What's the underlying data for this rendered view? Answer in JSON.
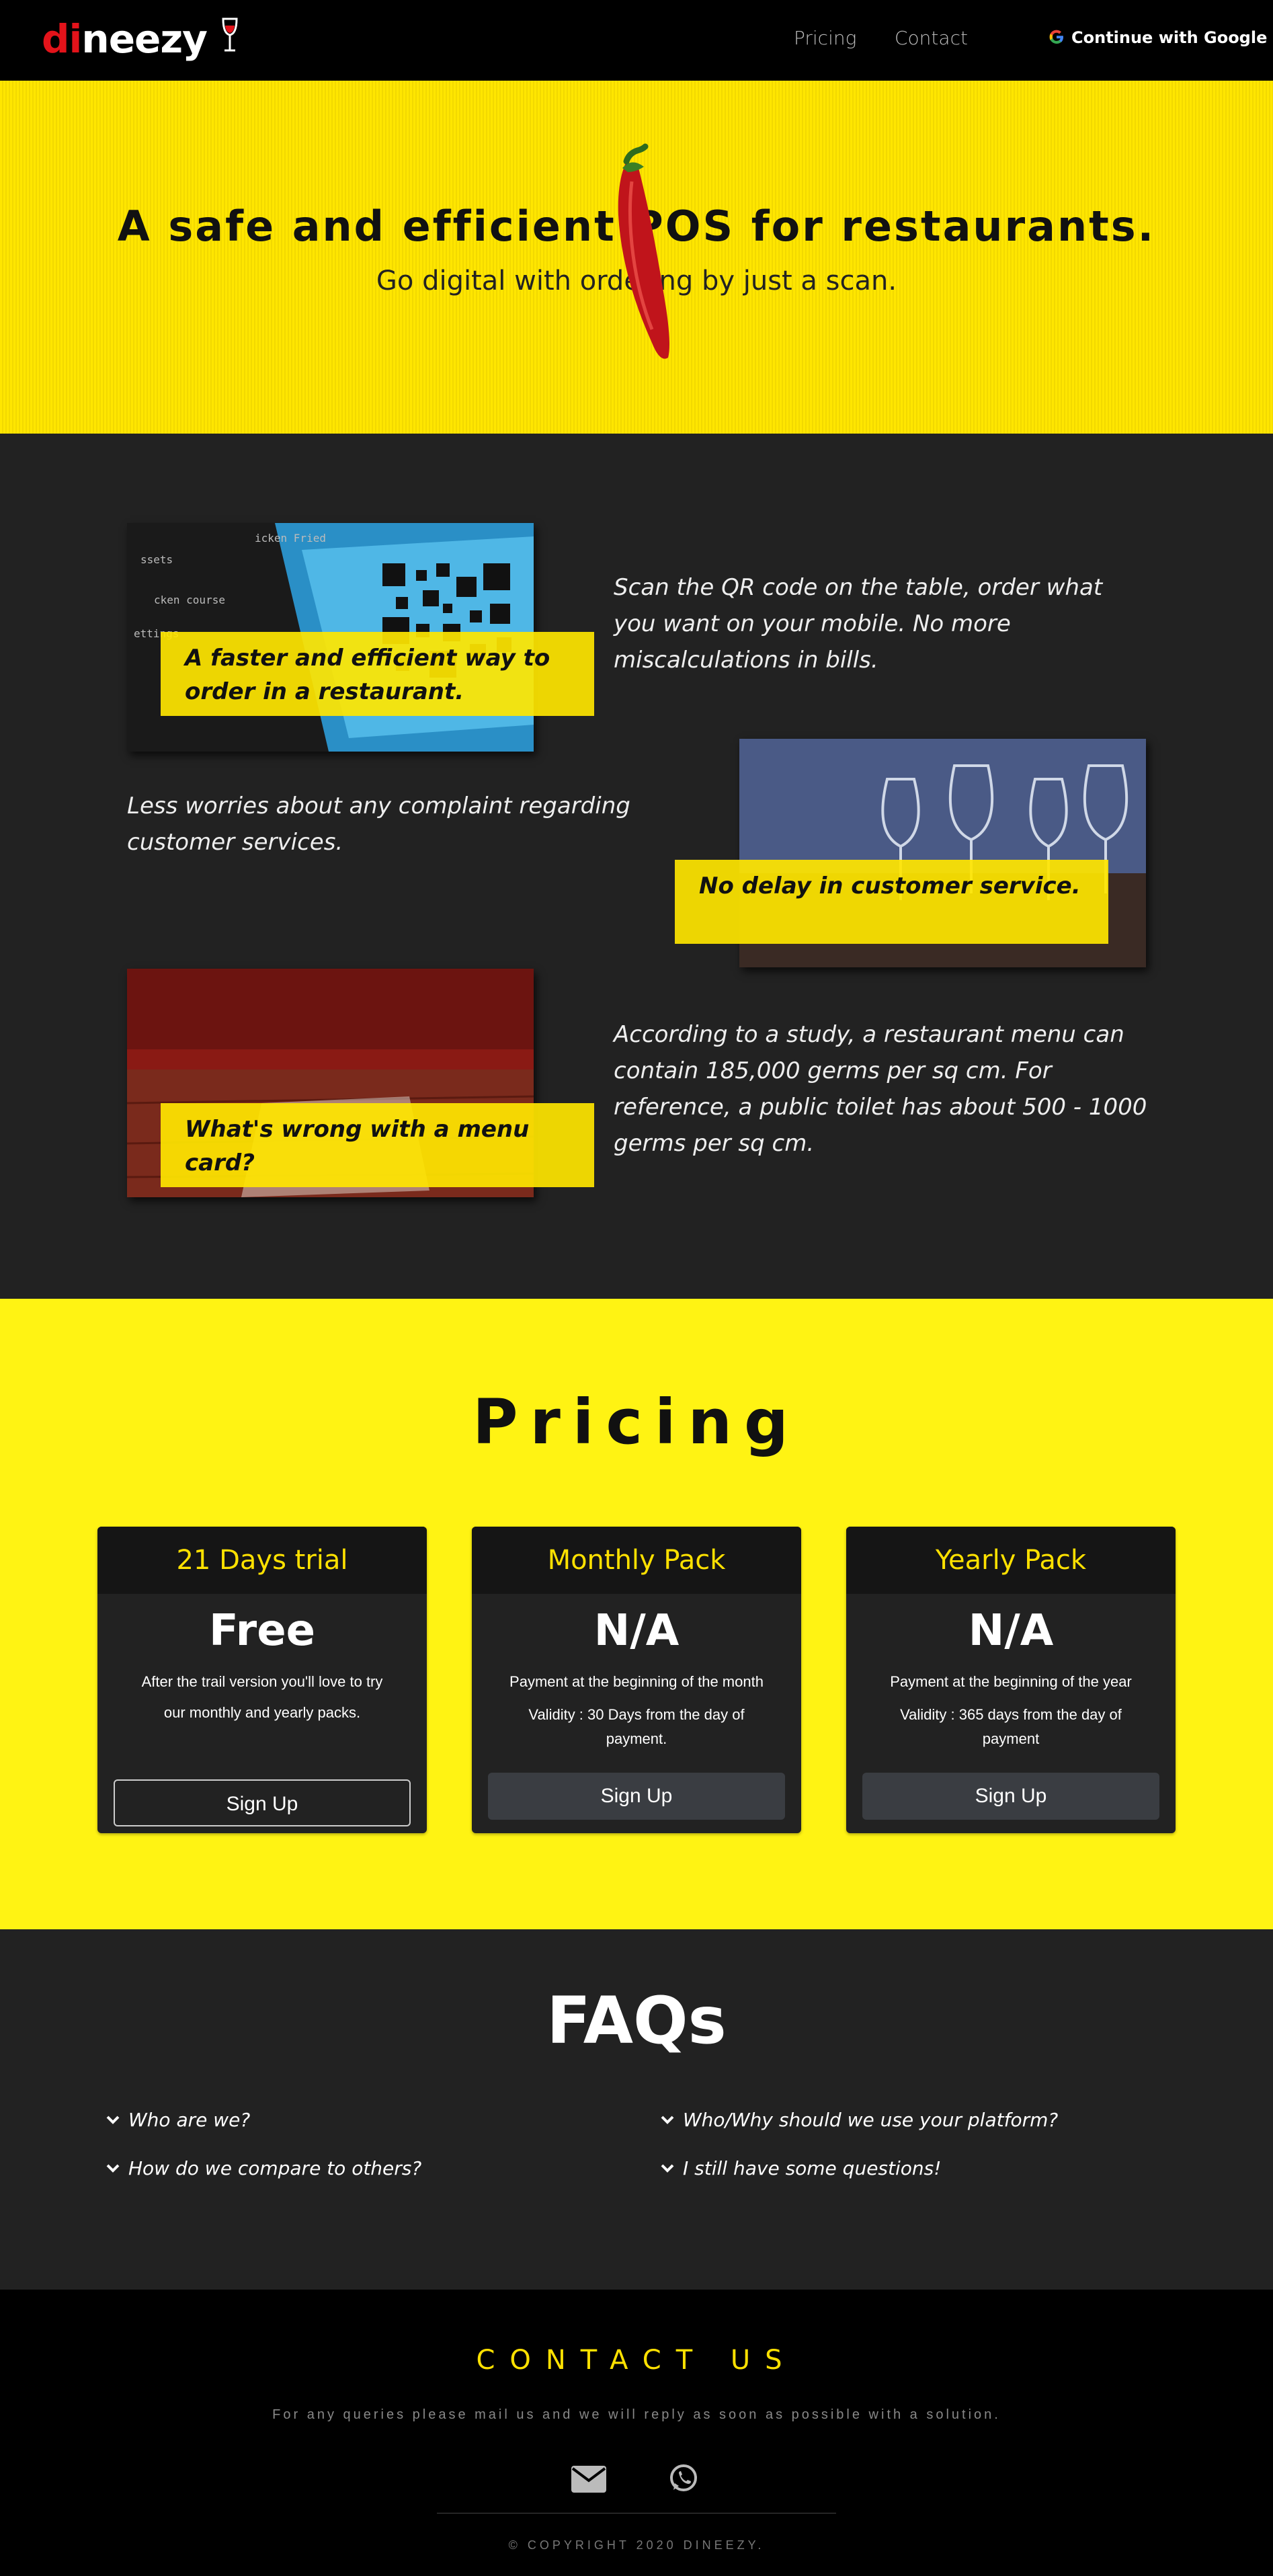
{
  "nav": {
    "logo_part1": "di",
    "logo_part2": "neez",
    "logo_part3": "y",
    "links": [
      "Pricing",
      "Contact"
    ],
    "google_label": "Continue with Google"
  },
  "hero": {
    "title": "A safe and efficient POS for restaurants.",
    "subtitle": "Go digital with ordering by just a scan."
  },
  "features": [
    {
      "label": "A faster and efficient way to order in a restaurant.",
      "text": "Scan the QR code on the table, order what you want on your mobile. No more miscalculations in bills."
    },
    {
      "label": "No delay in customer service.",
      "text": "Less worries about any complaint regarding customer services."
    },
    {
      "label": "What's wrong with a menu card?",
      "text": "According to a study, a restaurant menu can contain 185,000 germs per sq cm. For reference, a public toilet has about 500 - 1000 germs per sq cm."
    }
  ],
  "pricing": {
    "title": "Pricing",
    "cards": [
      {
        "name": "21 Days trial",
        "price": "Free",
        "desc": "After the trail version you'll love to try our monthly and yearly packs.",
        "button": "Sign Up"
      },
      {
        "name": "Monthly Pack",
        "price": "N/A",
        "line1": "Payment at the beginning of the month",
        "line2": "Validity : 30 Days from the day of payment.",
        "button": "Sign Up"
      },
      {
        "name": "Yearly Pack",
        "price": "N/A",
        "line1": "Payment at the beginning of the year",
        "line2": "Validity : 365 days from the day of payment",
        "button": "Sign Up"
      }
    ]
  },
  "faq": {
    "title": "FAQs",
    "items": [
      "Who are we?",
      "Who/Why should we use your platform?",
      "How do we compare to others?",
      "I still have some questions!"
    ]
  },
  "contact": {
    "title": "CONTACT US",
    "text": "For any queries please mail us and we will reply as soon as possible with a solution.",
    "copyright": "© COPYRIGHT 2020 DINEEZY."
  },
  "colors": {
    "accent": "#ffe600",
    "pricing_bg": "#fff313",
    "dark": "#222222",
    "logo_red": "#e3131a"
  },
  "icons": [
    "google-icon",
    "chili-icon",
    "qr-image",
    "wine-glasses-image",
    "menu-card-image",
    "chevron-down-icon",
    "envelope-icon",
    "whatsapp-icon"
  ]
}
